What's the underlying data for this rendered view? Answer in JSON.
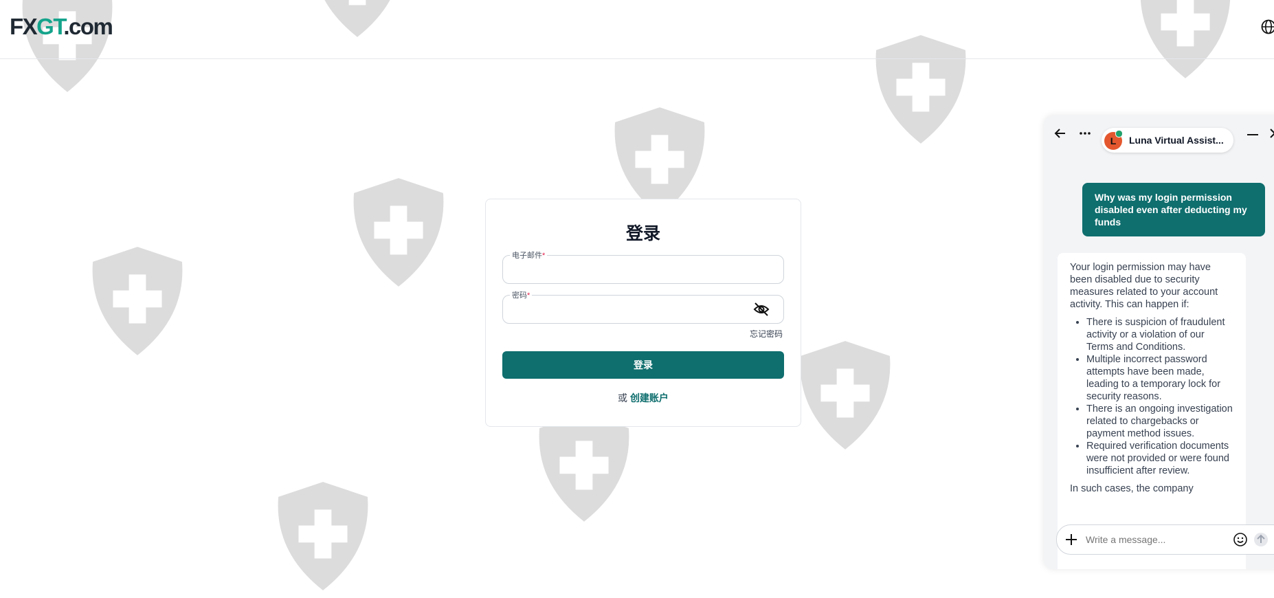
{
  "header": {
    "logo_prefix": "FX",
    "logo_accent": "GT",
    "logo_suffix": ".com",
    "language_icon": "globe-icon"
  },
  "login": {
    "title": "登录",
    "email_label": "电子邮件",
    "email_required": "*",
    "password_label": "密码",
    "password_required": "*",
    "toggle_visibility_icon": "eye-off-icon",
    "forgot_password": "忘记密码",
    "login_button": "登录",
    "or_text": "或",
    "create_account": "创建账户"
  },
  "chat": {
    "agent_name": "Luna Virtual Assist...",
    "agent_initial": "L",
    "user_message": "Why was my login permission disabled even after deducting my funds",
    "bot_intro": "Your login permission may have been disabled due to security measures related to your account activity. This can happen if:",
    "bot_reasons": [
      "There is suspicion of fraudulent activity or a violation of our Terms and Conditions.",
      "Multiple incorrect password attempts have been made, leading to a temporary lock for security reasons.",
      "There is an ongoing investigation related to chargebacks or payment method issues.",
      "Required verification documents were not provided or were found insufficient after review."
    ],
    "bot_outro": "In such cases, the company",
    "composer_placeholder": "Write a message..."
  },
  "colors": {
    "primary": "#0f6e6e",
    "logo_accent": "#14a38b",
    "watermark": "#dcdcdc",
    "avatar": "#e4572e",
    "online": "#22a06b"
  }
}
